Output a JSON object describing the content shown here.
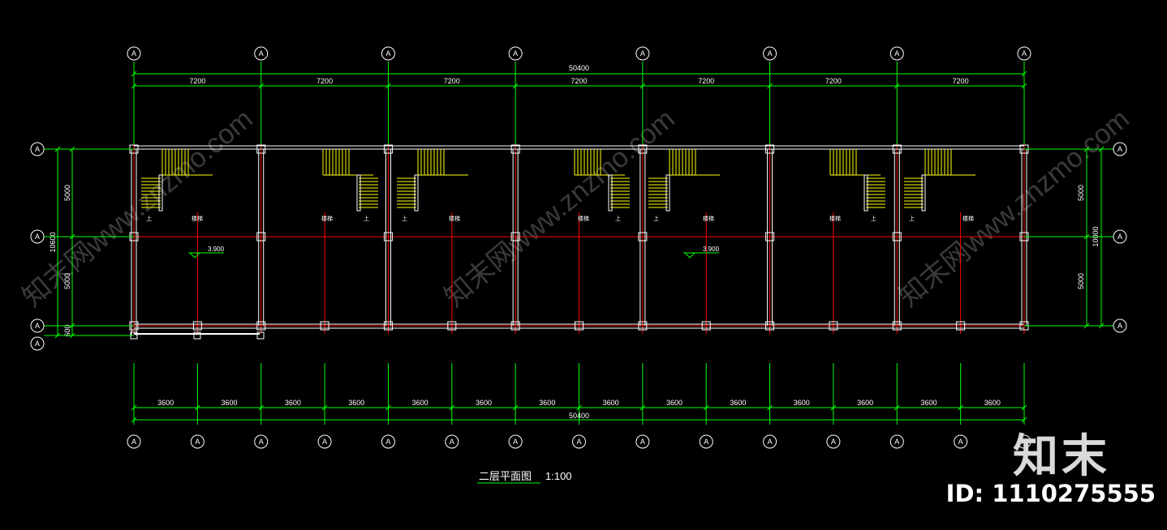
{
  "drawing": {
    "title": "二层平面图",
    "scale": "1:100",
    "axis_bubble_label": "A",
    "colors": {
      "background": "#000000",
      "grid_axis": "#ff0000",
      "dimension": "#00ff00",
      "wall": "#ffffff",
      "stair": "#ffff00",
      "column": "#ff0000"
    },
    "top_total": "50400",
    "top_spans": [
      "7200",
      "7200",
      "7200",
      "7200",
      "7200",
      "7200",
      "7200"
    ],
    "bottom_total": "50400",
    "bottom_spans": [
      "3600",
      "3600",
      "3600",
      "3600",
      "3600",
      "3600",
      "3600",
      "3600",
      "3600",
      "3600",
      "3600",
      "3600",
      "3600",
      "3600"
    ],
    "left_dims": [
      "5000",
      "10600",
      "5000",
      "600"
    ],
    "right_dims": [
      "5000",
      "10000",
      "5000"
    ],
    "elevation_labels": [
      "3.900",
      "3.900"
    ],
    "stair_label": "上",
    "stair_marks": [
      "楼梯",
      "楼梯",
      "楼梯",
      "楼梯",
      "楼梯",
      "楼梯",
      "楼梯"
    ],
    "watermark_text": "知末网www.znzmo.com"
  },
  "brand": {
    "logo_text": "知末",
    "id_text": "ID: 1110275555"
  }
}
